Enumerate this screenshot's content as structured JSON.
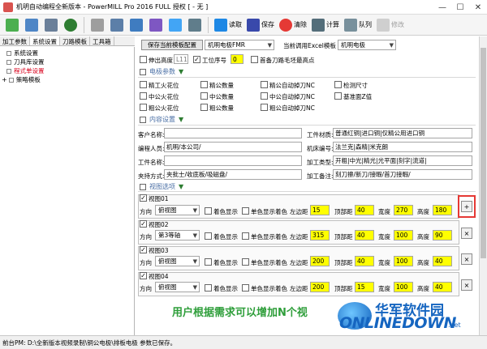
{
  "window": {
    "title": "机明自动编程全新版本 - PowerMILL Pro 2016 FULL 授权  [ - 无 ]",
    "controls": [
      "—",
      "☐",
      "✕"
    ]
  },
  "toolbar": {
    "load_label": "读取",
    "save_label": "保存",
    "clear_label": "清除",
    "calc_label": "计算",
    "queue_label": "队列",
    "modify_label": "修改"
  },
  "left_tabs": [
    "加工参数",
    "系统设置",
    "刀路模板",
    "工具箱"
  ],
  "tree": [
    "系统设置",
    "刀具库设置",
    "程式单设置",
    "策略模板"
  ],
  "top_row": {
    "save_template_button": "保存当前模板配置",
    "template_select": "机明电极FMR",
    "excel_template_label": "当前调用Excel模板",
    "excel_template_select": "机明电极"
  },
  "options_row": {
    "extend_height_label": "伸出高度",
    "extend_height_value": "L11",
    "process_no_label": "工位序号",
    "process_no_value": "0",
    "first_tool_label": "首备刀路毛坯最高点"
  },
  "electrode_section": {
    "title": "电极参数",
    "rows": [
      [
        "精工火花位",
        "精公数量",
        "精公自动掉刀NC",
        "检测尺寸"
      ],
      [
        "中公火花位",
        "中公数量",
        "中公自动掉刀NC",
        "基准面Z值"
      ],
      [
        "粗公火花位",
        "粗公数量",
        "粗公自动掉刀NC",
        ""
      ]
    ]
  },
  "content_section": {
    "title": "内容设置",
    "customer_label": "客户名称:",
    "customer_value": "",
    "material_label": "工件材质:",
    "material_value": "普通红铜|进口铜|仅精公用进口铜",
    "programmer_label": "编程人员:",
    "programmer_value": "机明/本公司/",
    "machine_label": "机床编号:",
    "machine_value": "法兰克|森精|米克朗",
    "workpiece_label": "工件名称:",
    "workpiece_value": "",
    "process_type_label": "加工类型:",
    "process_type_value": "开粗|中光|精光|光平面|刻字|流道|",
    "clamp_label": "夹持方式:",
    "clamp_value": "夹批士/收底板/吸磁盘/",
    "remark_label": "加工备注:",
    "remark_value": "刻刀擦/新刀/接暇/首刀接暇/"
  },
  "view_section": {
    "title": "视图选项",
    "direction_label": "方向",
    "mono_label": "着色显示",
    "single_label": "单色显示着色",
    "left_label": "左边距",
    "top_label": "顶部距",
    "width_label": "宽度",
    "height_label": "高度",
    "views": [
      {
        "name": "视图01",
        "direction": "俯视图",
        "left": "15",
        "top": "40",
        "width": "270",
        "height": "180",
        "action": "+"
      },
      {
        "name": "视图02",
        "direction": "第3等轴",
        "left": "315",
        "top": "40",
        "width": "100",
        "height": "90",
        "action": "×"
      },
      {
        "name": "视图03",
        "direction": "俯视图",
        "left": "200",
        "top": "40",
        "width": "100",
        "height": "40",
        "action": "×"
      },
      {
        "name": "视图04",
        "direction": "俯视图",
        "left": "200",
        "top": "15",
        "width": "100",
        "height": "40",
        "action": "×"
      }
    ]
  },
  "hint_text": "用户根据需求可以增加N个视",
  "watermark": {
    "cn": "华军软件园",
    "en": "ONLINEDOWN",
    "suffix": ".net"
  },
  "status": {
    "text": "前台PM: D:\\全新版本视频录制\\铜公电极\\排板电极  参数已保存。"
  },
  "colors": {
    "accent_green": "#2e9e3a",
    "highlight_yellow": "#ffff00",
    "selection_red": "#d9001b",
    "frame_red": "#e53935"
  }
}
